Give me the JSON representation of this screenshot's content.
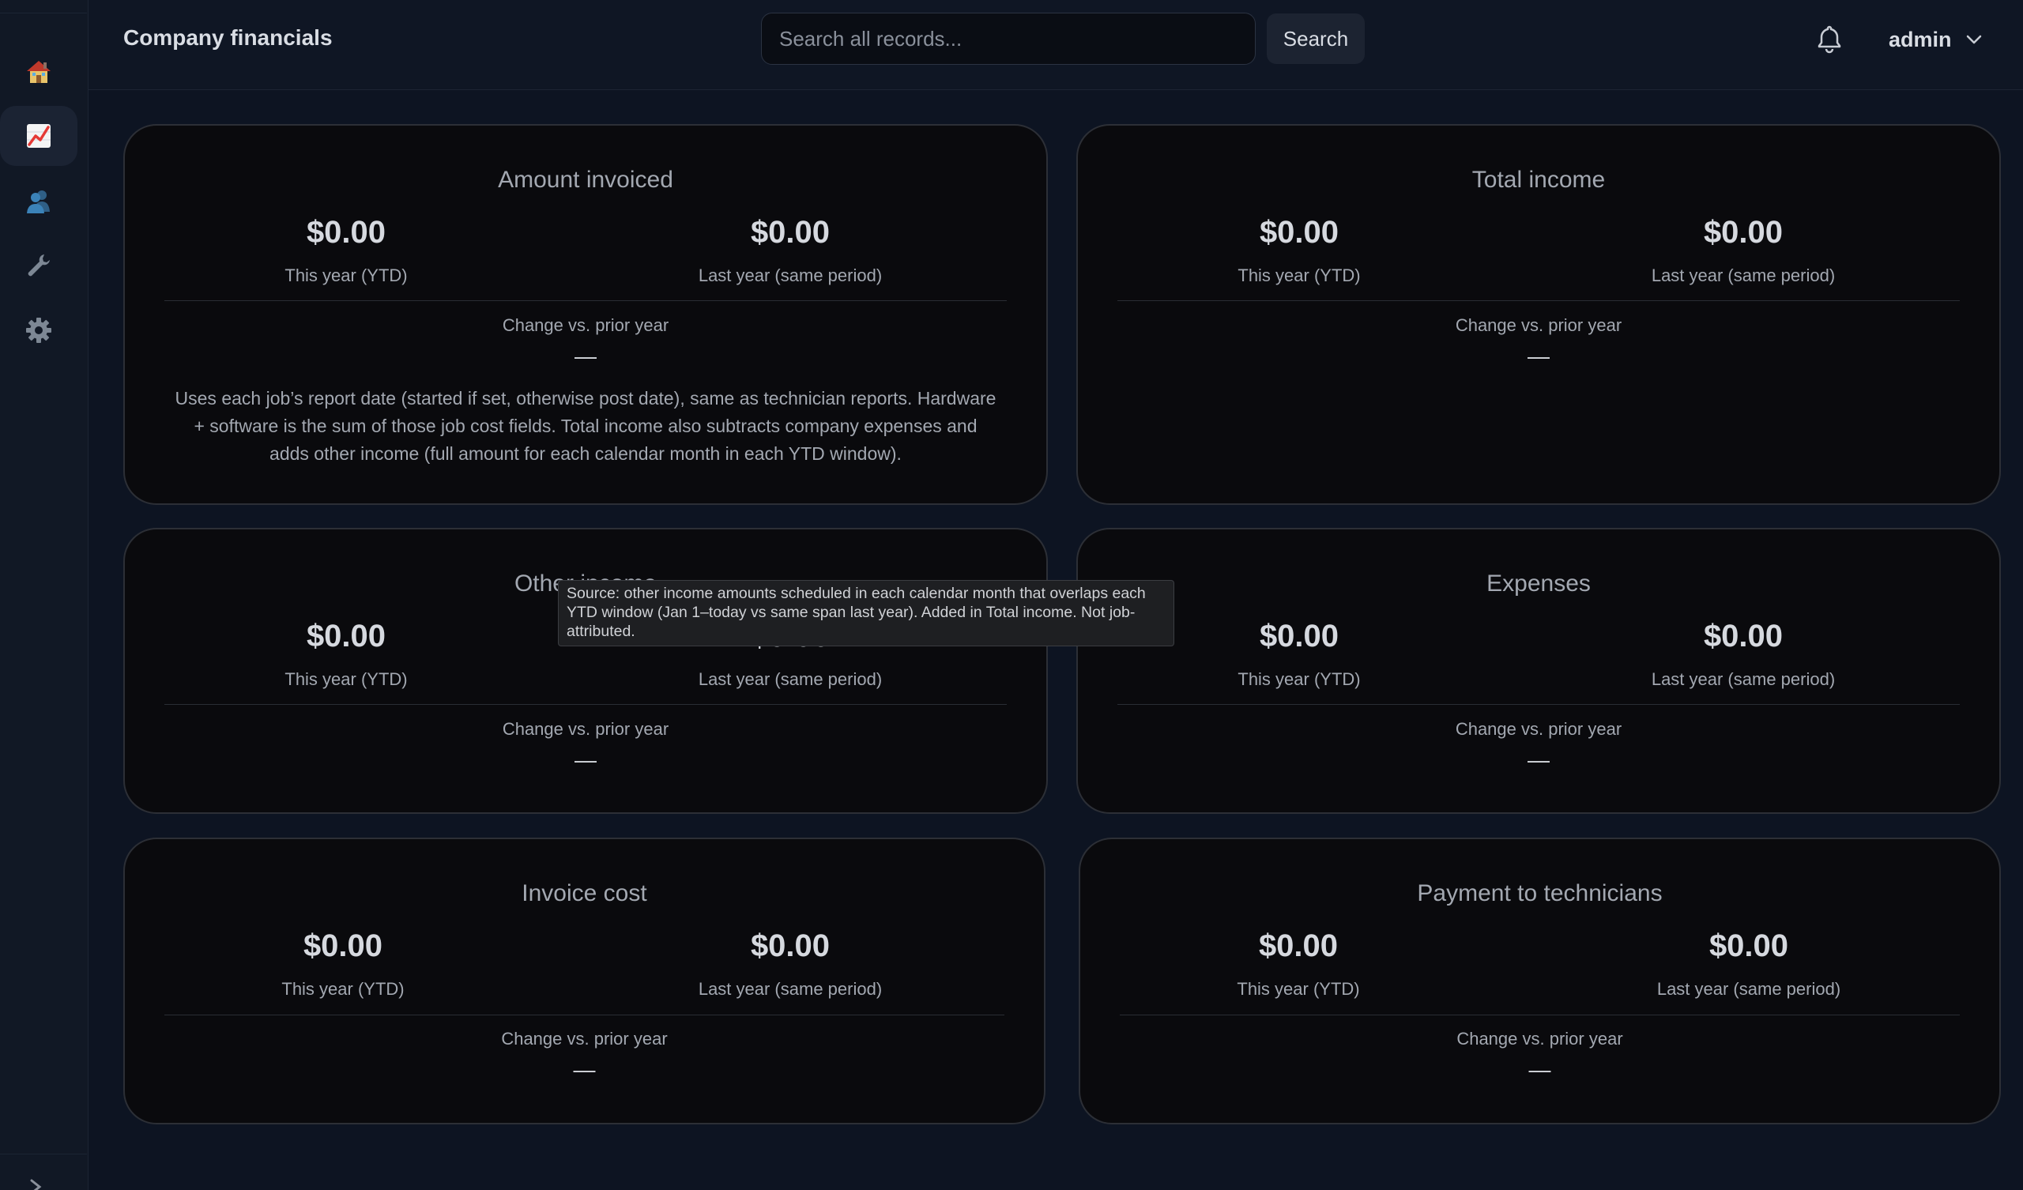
{
  "app": {
    "page_title": "Company financials"
  },
  "sidebar": {
    "items": [
      {
        "icon": "house-icon"
      },
      {
        "icon": "chart-increasing-icon",
        "active": true
      },
      {
        "icon": "users-icon"
      },
      {
        "icon": "wrench-icon"
      },
      {
        "icon": "gear-icon"
      }
    ]
  },
  "header": {
    "search_placeholder": "Search all records...",
    "search_button": "Search",
    "user": "admin"
  },
  "cards": [
    {
      "title": "Amount invoiced",
      "this_year_value": "$0.00",
      "this_year_label": "This year (YTD)",
      "last_year_value": "$0.00",
      "last_year_label": "Last year (same period)",
      "change_label": "Change vs. prior year",
      "change_value": "—",
      "note": "Uses each job’s report date (started if set, otherwise post date), same as technician reports. Hardware + software is the sum of those job cost fields. Total income also subtracts company expenses and adds other income (full amount for each calendar month in each YTD window)."
    },
    {
      "title": "Total income",
      "this_year_value": "$0.00",
      "this_year_label": "This year (YTD)",
      "last_year_value": "$0.00",
      "last_year_label": "Last year (same period)",
      "change_label": "Change vs. prior year",
      "change_value": "—"
    },
    {
      "title": "Other income",
      "this_year_value": "$0.00",
      "this_year_label": "This year (YTD)",
      "last_year_value": "$0.00",
      "last_year_label": "Last year (same period)",
      "change_label": "Change vs. prior year",
      "change_value": "—"
    },
    {
      "title": "Expenses",
      "this_year_value": "$0.00",
      "this_year_label": "This year (YTD)",
      "last_year_value": "$0.00",
      "last_year_label": "Last year (same period)",
      "change_label": "Change vs. prior year",
      "change_value": "—"
    },
    {
      "title": "Invoice cost",
      "this_year_value": "$0.00",
      "this_year_label": "This year (YTD)",
      "last_year_value": "$0.00",
      "last_year_label": "Last year (same period)",
      "change_label": "Change vs. prior year",
      "change_value": "—"
    },
    {
      "title": "Payment to technicians",
      "this_year_value": "$0.00",
      "this_year_label": "This year (YTD)",
      "last_year_value": "$0.00",
      "last_year_label": "Last year (same period)",
      "change_label": "Change vs. prior year",
      "change_value": "—"
    }
  ],
  "tooltip": {
    "text": "Source: other income amounts scheduled in each calendar month that overlaps each YTD window (Jan 1–today vs same span last year). Added in Total income. Not job-attributed."
  },
  "colors": {
    "page_background": "#0d1422",
    "card_background": "#0a0a0d",
    "card_border": "#2c2f36",
    "muted_text": "#a3a8b1",
    "value_text": "#d6d9df"
  }
}
